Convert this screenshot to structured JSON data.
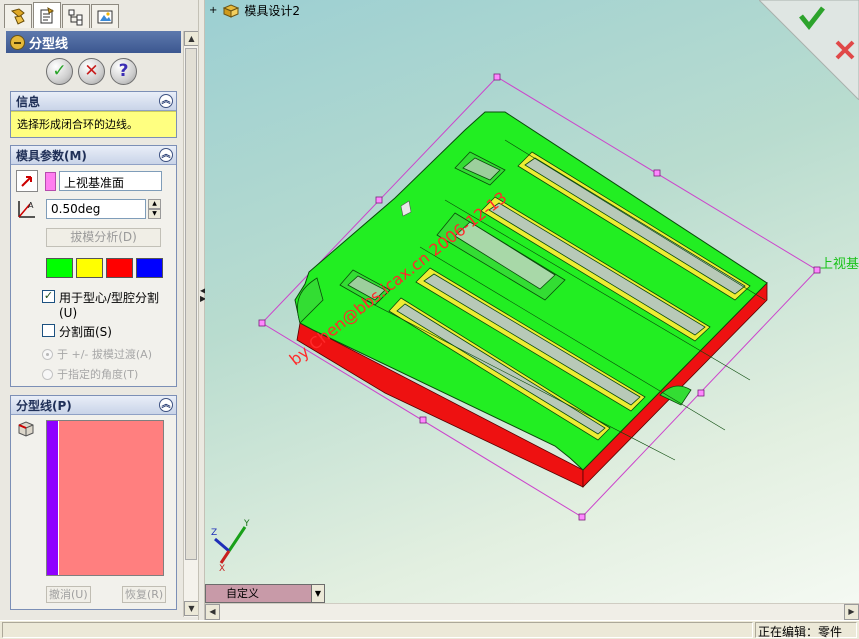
{
  "left_panel": {
    "feature_title": "分型线",
    "info": {
      "header": "信息",
      "message": "选择形成闭合环的边线。"
    },
    "mold_params": {
      "header": "模具参数(M)",
      "direction_value": "上视基准面",
      "draft_angle_value": "0.50deg",
      "draft_analysis_label": "拔模分析(D)",
      "colors": [
        "#00ff00",
        "#ffff00",
        "#ff0000",
        "#0000ff"
      ],
      "core_cavity_label": "用于型心/型腔分割(U)",
      "core_cavity_checked": true,
      "split_faces_label": "分割面(S)",
      "split_faces_checked": false,
      "option_transition_label": "于 +/- 拔模过渡(A)",
      "option_angle_label": "于指定的角度(T)"
    },
    "parting_line": {
      "header": "分型线(P)",
      "undo_label": "撤消(U)",
      "redo_label": "恢复(R)"
    }
  },
  "viewport": {
    "tree_item_label": "模具设计2",
    "plane_label": "上视基",
    "watermark": "by Chen@bbs.icax.cn 2006-12-13",
    "triad": {
      "x": "X",
      "y": "Y",
      "z": "Z"
    },
    "view_orientation_value": "自定义"
  },
  "status_bar": {
    "text": "正在编辑：零件"
  }
}
